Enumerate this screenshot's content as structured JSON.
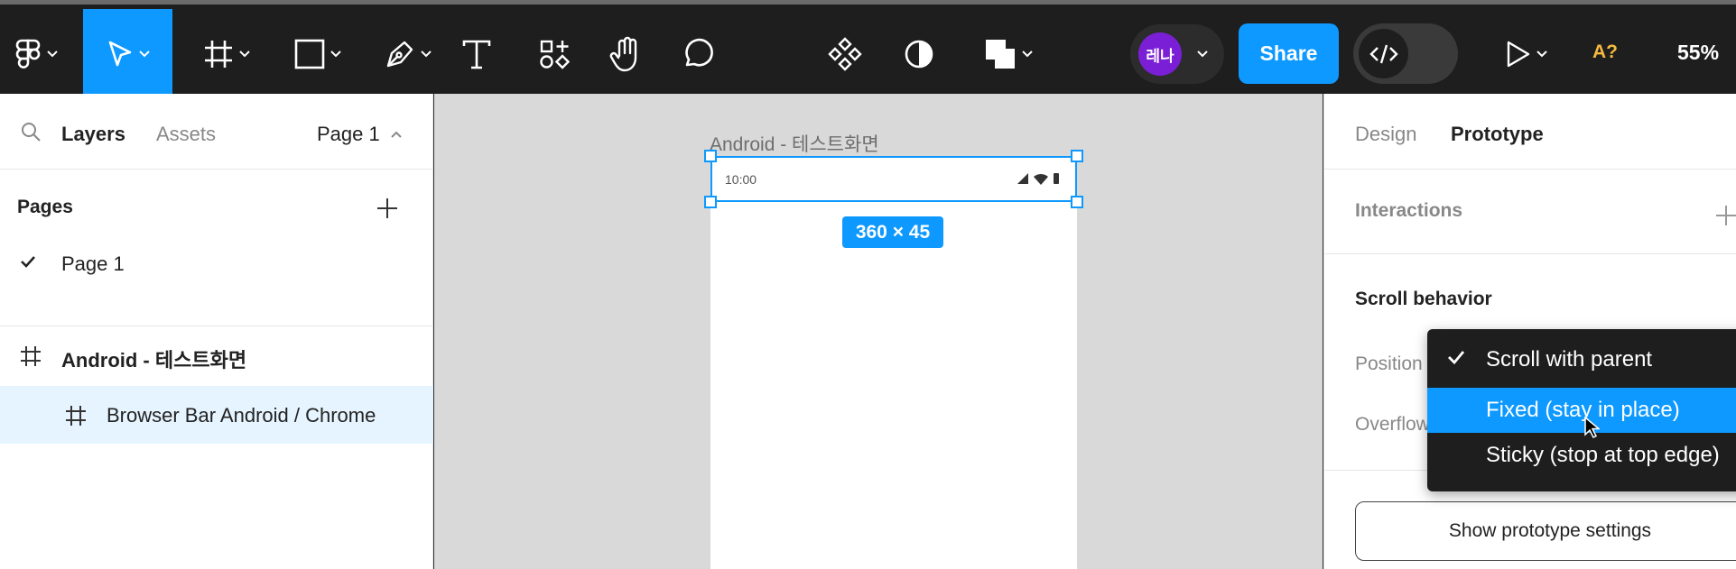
{
  "toolbar": {
    "avatar_initials": "레나",
    "share_label": "Share",
    "ai_label": "A?",
    "zoom_label": "55%",
    "icons": [
      "figma-menu-icon",
      "move-tool-icon",
      "frame-tool-icon",
      "rectangle-tool-icon",
      "pen-tool-icon",
      "text-tool-icon",
      "resources-icon",
      "hand-tool-icon",
      "comment-icon",
      "component-icon",
      "contrast-icon",
      "boolean-icon",
      "code-icon",
      "play-icon"
    ]
  },
  "left_panel": {
    "tabs": [
      "Layers",
      "Assets"
    ],
    "page_selector": "Page 1",
    "pages_title": "Pages",
    "pages": [
      "Page 1"
    ],
    "layers": [
      {
        "label": "Android - 테스트화면",
        "selected": false,
        "bold": true
      },
      {
        "label": "Browser Bar Android / Chrome",
        "selected": true,
        "bold": false
      }
    ]
  },
  "canvas": {
    "frame_name": "Android - 테스트화면",
    "status_time": "10:00",
    "size_badge": "360 × 45"
  },
  "right_panel": {
    "tabs": [
      "Design",
      "Prototype"
    ],
    "active_tab": "Prototype",
    "interactions_title": "Interactions",
    "scroll_title": "Scroll behavior",
    "position_label": "Position",
    "overflow_label": "Overflow",
    "prototype_settings_button": "Show prototype settings"
  },
  "dropdown": {
    "items": [
      {
        "label": "Scroll with parent",
        "checked": true,
        "highlighted": false
      },
      {
        "label": "Fixed (stay in place)",
        "checked": false,
        "highlighted": true
      },
      {
        "label": "Sticky (stop at top edge)",
        "checked": false,
        "highlighted": false
      }
    ]
  },
  "colors": {
    "accent": "#0d99ff",
    "toolbar_bg": "#1e1e1e",
    "canvas_bg": "#d9d9d9",
    "avatar_bg": "#7b1fd6",
    "ai_label": "#f5b93f"
  }
}
